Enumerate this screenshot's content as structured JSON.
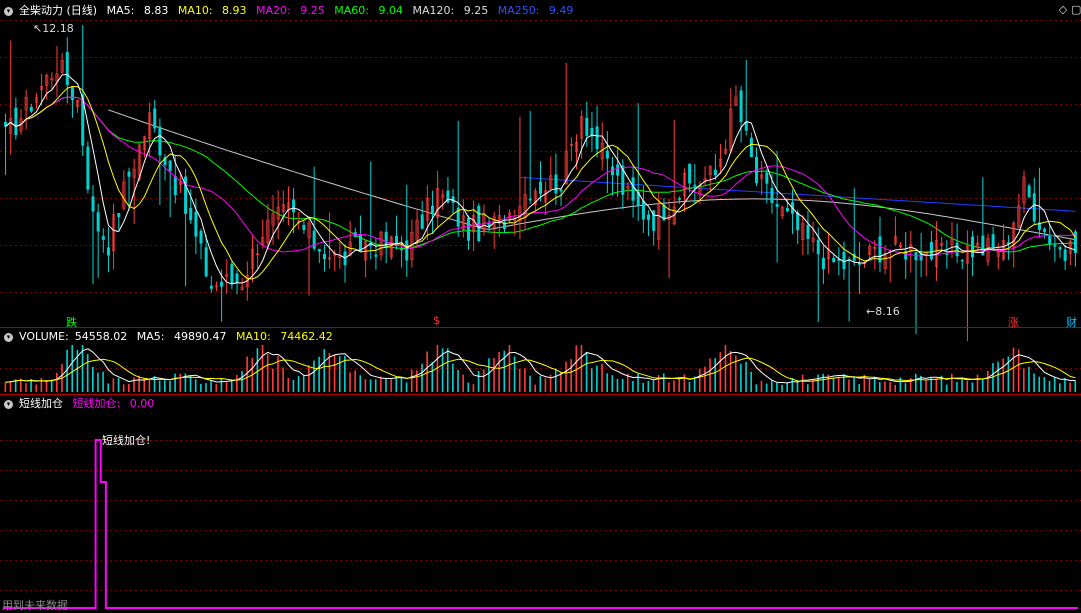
{
  "price_panel": {
    "title": "全柴动力 (日线)",
    "ma5": {
      "label": "MA5:",
      "value": "8.83",
      "color": "#ffffff"
    },
    "ma10": {
      "label": "MA10:",
      "value": "8.93",
      "color": "#ffff00"
    },
    "ma20": {
      "label": "MA20:",
      "value": "9.25",
      "color": "#ff00ff"
    },
    "ma60": {
      "label": "MA60:",
      "value": "9.04",
      "color": "#00ff00"
    },
    "ma120": {
      "label": "MA120:",
      "value": "9.25",
      "color": "#c8c8c8"
    },
    "ma250": {
      "label": "MA250:",
      "value": "9.49",
      "color": "#0000ff"
    },
    "high_marker": "12.18",
    "low_marker": "8.16",
    "signals": [
      {
        "text": "跌",
        "color": "#00ff00"
      },
      {
        "text": "$",
        "color": "#ff3030"
      },
      {
        "text": "涨",
        "color": "#ff3030"
      },
      {
        "text": "财",
        "color": "#00c0ff"
      }
    ]
  },
  "volume_panel": {
    "title": "VOLUME:",
    "value": "54558.02",
    "ma5": {
      "label": "MA5:",
      "value": "49890.47"
    },
    "ma10": {
      "label": "MA10:",
      "value": "74462.42"
    }
  },
  "indicator_panel": {
    "title": "短线加仓",
    "series_label": "短线加仓:",
    "series_value": "0.00",
    "annotation": "短线加仓!",
    "footer": "用到未来数据"
  },
  "controls": {
    "diamond_icon": "diamond-icon",
    "square_icon": "square-icon"
  },
  "colors": {
    "up": "#ff3c3c",
    "down": "#00d2d2",
    "grid": "#7a0000",
    "separator": "#b00000",
    "indicator": "#ff00ff",
    "background": "#000000"
  },
  "chart_data": [
    {
      "type": "candlestick",
      "title": "全柴动力 (日线)",
      "bars": 209,
      "y_range": [
        7.9,
        12.6
      ],
      "marked_high": 12.18,
      "marked_low": 8.16,
      "close_anchors": [
        [
          0,
          10.7
        ],
        [
          6,
          11.4
        ],
        [
          10,
          11.9
        ],
        [
          14,
          11.3
        ],
        [
          17,
          9.4
        ],
        [
          20,
          9.0
        ],
        [
          24,
          10.1
        ],
        [
          28,
          11.0
        ],
        [
          32,
          10.2
        ],
        [
          36,
          9.3
        ],
        [
          40,
          8.3
        ],
        [
          46,
          8.4
        ],
        [
          50,
          9.2
        ],
        [
          55,
          9.5
        ],
        [
          60,
          9.0
        ],
        [
          65,
          8.7
        ],
        [
          70,
          9.0
        ],
        [
          78,
          8.9
        ],
        [
          84,
          9.8
        ],
        [
          90,
          9.2
        ],
        [
          96,
          9.3
        ],
        [
          102,
          9.9
        ],
        [
          108,
          10.0
        ],
        [
          112,
          11.1
        ],
        [
          116,
          10.4
        ],
        [
          122,
          9.6
        ],
        [
          126,
          9.4
        ],
        [
          132,
          9.9
        ],
        [
          138,
          10.1
        ],
        [
          142,
          11.3
        ],
        [
          146,
          10.0
        ],
        [
          150,
          9.6
        ],
        [
          155,
          9.1
        ],
        [
          160,
          8.7
        ],
        [
          165,
          8.6
        ],
        [
          170,
          8.9
        ],
        [
          176,
          8.9
        ],
        [
          182,
          8.8
        ],
        [
          188,
          8.9
        ],
        [
          194,
          8.9
        ],
        [
          198,
          9.9
        ],
        [
          202,
          9.2
        ],
        [
          206,
          8.8
        ],
        [
          208,
          8.8
        ]
      ],
      "series": [
        {
          "name": "MA5",
          "value": 8.83
        },
        {
          "name": "MA10",
          "value": 8.93
        },
        {
          "name": "MA20",
          "value": 9.25
        },
        {
          "name": "MA60",
          "value": 9.04
        },
        {
          "name": "MA120",
          "value": 9.25
        },
        {
          "name": "MA250",
          "value": 9.49
        }
      ]
    },
    {
      "type": "bar",
      "title": "VOLUME",
      "last_value": 54558.02,
      "spike_bars": [
        14,
        50,
        63,
        84,
        97,
        112,
        140,
        195
      ],
      "series": [
        {
          "name": "MA5",
          "value": 49890.47
        },
        {
          "name": "MA10",
          "value": 74462.42
        }
      ]
    },
    {
      "type": "line",
      "title": "短线加仓",
      "values_nonzero": [
        [
          18,
          1.0
        ],
        [
          19,
          0.75
        ]
      ],
      "other_values": 0,
      "last_value": 0.0
    }
  ]
}
